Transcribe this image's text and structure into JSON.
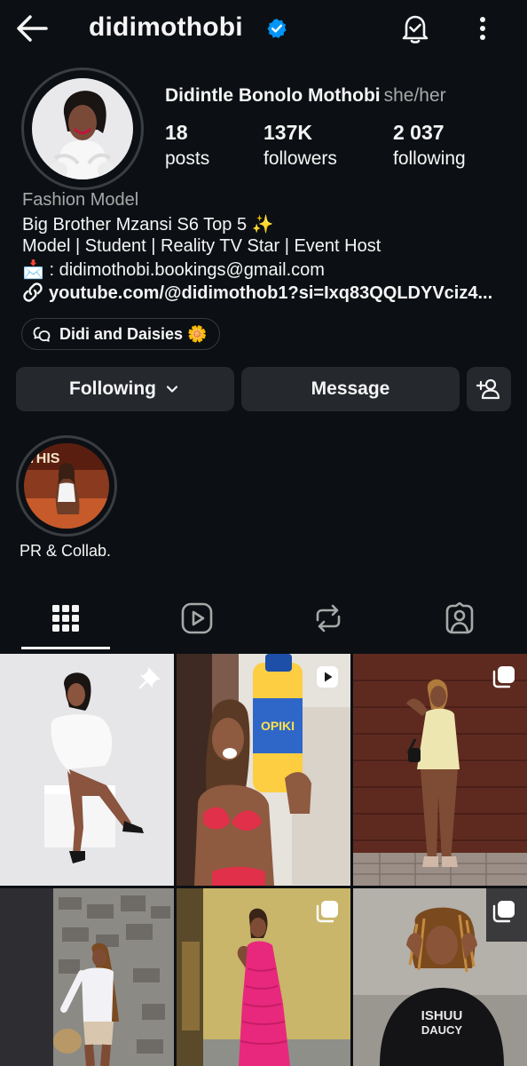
{
  "header": {
    "username": "didimothobi",
    "icons": {
      "back": "arrow-left-icon",
      "verified": "verified-badge-icon",
      "notifications": "bell-check-icon",
      "more": "more-vertical-icon"
    }
  },
  "profile": {
    "full_name": "Didintle Bonolo Mothobi",
    "pronouns": "she/her",
    "stats": [
      {
        "value": "18",
        "label": "posts"
      },
      {
        "value": "137K",
        "label": "followers"
      },
      {
        "value": "2 037",
        "label": "following"
      }
    ],
    "category": "Fashion Model",
    "bio_lines": [
      "Big Brother Mzansi S6 Top 5 ✨",
      "Model | Student | Reality TV Star | Event Host",
      "📩 : didimothobi.bookings@gmail.com"
    ],
    "link": "youtube.com/@didimothob1?si=Ixq83QQLDYVciz4...",
    "threads_chip": "Didi and Daisies 🌼"
  },
  "actions": {
    "following_label": "Following",
    "message_label": "Message"
  },
  "highlights": [
    {
      "label": "PR & Collab."
    }
  ],
  "tabs": [
    {
      "icon": "grid-icon",
      "active": true
    },
    {
      "icon": "reels-icon",
      "active": false
    },
    {
      "icon": "reposts-icon",
      "active": false
    },
    {
      "icon": "tagged-icon",
      "active": false
    }
  ],
  "colors": {
    "background": "#0c1014",
    "button": "#25292e",
    "verified": "#0095f6",
    "muted_text": "#a8a8a8"
  }
}
